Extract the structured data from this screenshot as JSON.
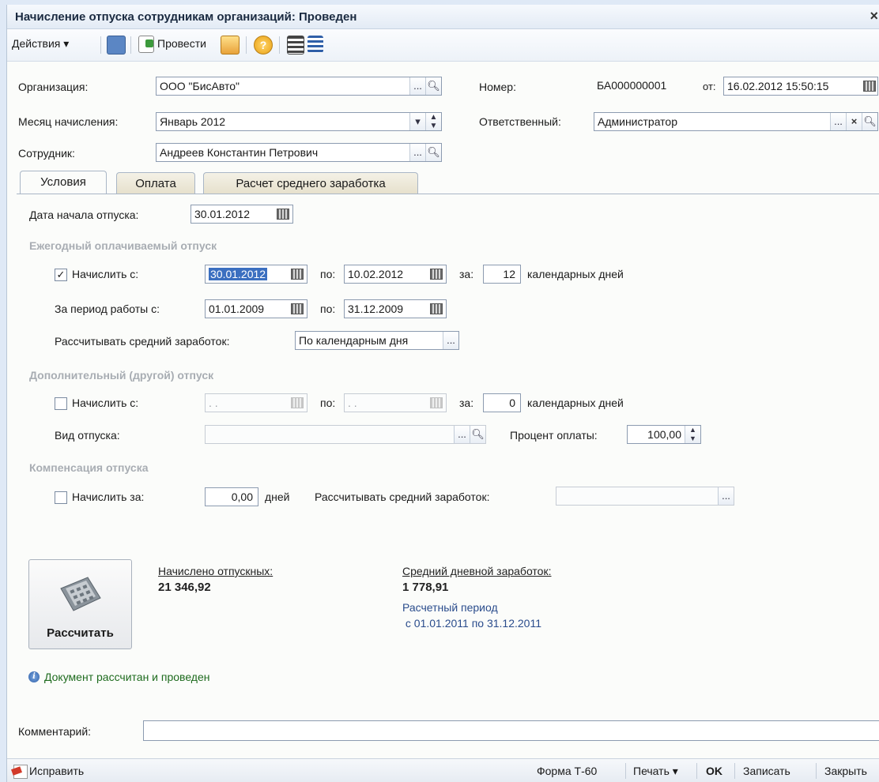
{
  "window": {
    "title": "Начисление отпуска сотрудникам организаций: Проведен",
    "close": "×"
  },
  "toolbar": {
    "actions": "Действия ▾",
    "post": "Провести"
  },
  "header": {
    "org_label": "Организация:",
    "org_value": "ООО \"БисАвто\"",
    "number_label": "Номер:",
    "number_value": "БА000000001",
    "from_label": "от:",
    "date_value": "16.02.2012 15:50:15",
    "month_label": "Месяц начисления:",
    "month_value": "Январь 2012",
    "resp_label": "Ответственный:",
    "resp_value": "Администратор",
    "emp_label": "Сотрудник:",
    "emp_value": "Андреев Константин Петрович"
  },
  "tabs": [
    "Условия",
    "Оплата",
    "Расчет среднего заработка"
  ],
  "conditions": {
    "start_label": "Дата начала отпуска:",
    "start_value": "30.01.2012",
    "annual_header": "Ежегодный оплачиваемый отпуск",
    "annual_accrue_label": "Начислить с:",
    "annual_from": "30.01.2012",
    "to_label": "по:",
    "annual_to": "10.02.2012",
    "for_label": "за:",
    "annual_days": "12",
    "days_label": "календарных дней",
    "period_label": "За период работы с:",
    "period_from": "01.01.2009",
    "period_to": "31.12.2009",
    "avg_calc_label": "Рассчитывать средний заработок:",
    "avg_calc_value": "По календарным дня",
    "extra_header": "Дополнительный (другой) отпуск",
    "extra_accrue_label": "Начислить с:",
    "extra_from": ". .",
    "extra_to": ". .",
    "extra_days": "0",
    "vac_type_label": "Вид отпуска:",
    "pay_percent_label": "Процент оплаты:",
    "pay_percent": "100,00",
    "comp_header": "Компенсация отпуска",
    "comp_accrue_label": "Начислить за:",
    "comp_days": "0,00",
    "comp_days_unit": "дней",
    "comp_avg_label": "Рассчитывать средний заработок:"
  },
  "results": {
    "calc_button": "Рассчитать",
    "accrued_label": "Начислено отпускных:",
    "accrued_value": "21 346,92",
    "avg_label": "Средний дневной заработок:",
    "avg_value": "1 778,91",
    "period_line1": "Расчетный период",
    "period_line2": " с 01.01.2011 по 31.12.2011"
  },
  "info": {
    "message": "Документ рассчитан и проведен"
  },
  "comment": {
    "label": "Комментарий:",
    "value": ""
  },
  "footer": {
    "fix": "Исправить",
    "form": "Форма Т-60",
    "print": "Печать ▾",
    "ok": "OK",
    "save": "Записать",
    "close": "Закрыть"
  }
}
